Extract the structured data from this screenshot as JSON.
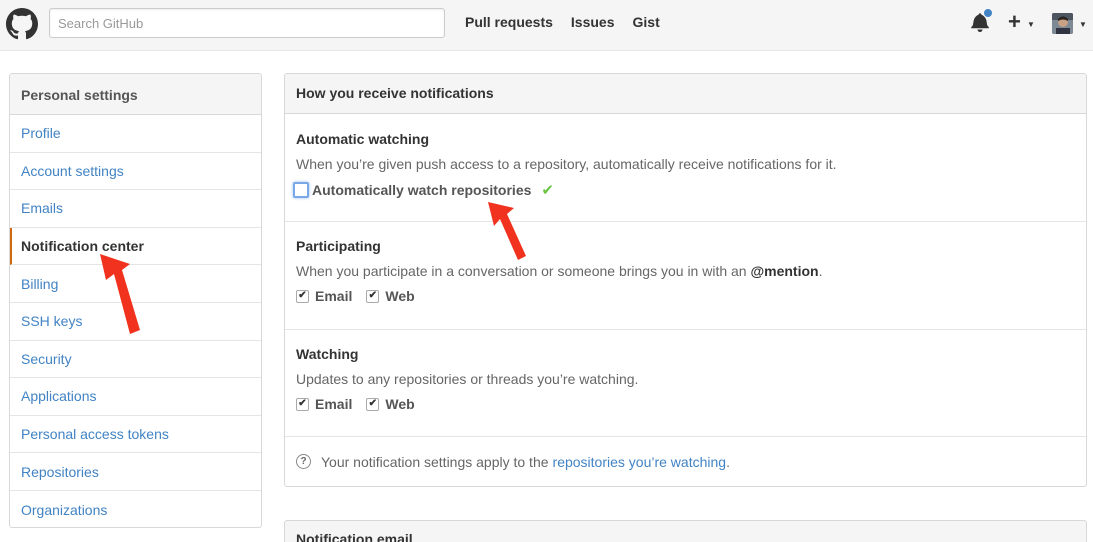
{
  "header": {
    "search_placeholder": "Search GitHub",
    "nav": [
      "Pull requests",
      "Issues",
      "Gist"
    ],
    "notification_dot_color": "#4183c4"
  },
  "sidebar": {
    "title": "Personal settings",
    "items": [
      {
        "label": "Profile"
      },
      {
        "label": "Account settings"
      },
      {
        "label": "Emails"
      },
      {
        "label": "Notification center",
        "selected": true
      },
      {
        "label": "Billing"
      },
      {
        "label": "SSH keys"
      },
      {
        "label": "Security"
      },
      {
        "label": "Applications"
      },
      {
        "label": "Personal access tokens"
      },
      {
        "label": "Repositories"
      },
      {
        "label": "Organizations"
      }
    ]
  },
  "main": {
    "title": "How you receive notifications",
    "automatic": {
      "heading": "Automatic watching",
      "description": "When you’re given push access to a repository, automatically receive notifications for it.",
      "checkbox_label": "Automatically watch repositories",
      "checked": false,
      "status_icon": "check-icon"
    },
    "participating": {
      "heading": "Participating",
      "description_prefix": "When you participate in a conversation or someone brings you in with an ",
      "mention": "@mention",
      "description_suffix": ".",
      "email_label": "Email",
      "web_label": "Web",
      "email_checked": true,
      "web_checked": true
    },
    "watching": {
      "heading": "Watching",
      "description": "Updates to any repositories or threads you’re watching.",
      "email_label": "Email",
      "web_label": "Web",
      "email_checked": true,
      "web_checked": true
    },
    "note_prefix": "Your notification settings apply to the ",
    "note_link": "repositories you’re watching",
    "note_suffix": "."
  },
  "next_section": {
    "title": "Notification email"
  },
  "colors": {
    "link": "#4183c4",
    "selected_accent": "#d26911",
    "success": "#6cc644",
    "annotation_arrow": "#f0321e"
  }
}
